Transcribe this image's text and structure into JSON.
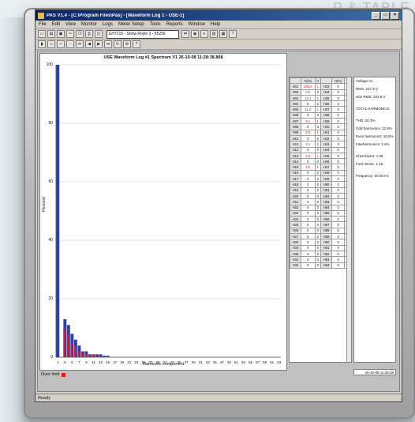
{
  "page": {
    "corner_caption": "P & TABLE"
  },
  "window": {
    "title": "PAS V1.4 - [C:\\Program Files\\Pas] - [Waveform Log 1 - USE-1]",
    "menu": [
      "File",
      "Edit",
      "View",
      "Monitor",
      "Logs",
      "Meter Setup",
      "Tools",
      "Reports",
      "Window",
      "Help"
    ],
    "device_combo": "EH7215 - Show Royle 3 - 85256"
  },
  "chart_data": {
    "type": "bar",
    "title": "USE Waveform Log #1 Spectrum V1 26-10-08 11:28:38.808",
    "xlabel": "Harmonic component",
    "ylabel": "Percent",
    "ylim": [
      0,
      100
    ],
    "yticks": [
      "0",
      "20",
      "40",
      "60",
      "80",
      "100"
    ],
    "xticks": [
      "1",
      "3",
      "5",
      "7",
      "9",
      "11",
      "13",
      "15",
      "17",
      "19",
      "21",
      "23",
      "25",
      "27",
      "29",
      "31",
      "33",
      "35",
      "37",
      "39",
      "41",
      "43",
      "45",
      "47",
      "49",
      "51",
      "53",
      "55",
      "57",
      "59",
      "61",
      "63"
    ],
    "series": [
      {
        "name": "Harmonics",
        "values": [
          100,
          0,
          13,
          11,
          8,
          6,
          4,
          2,
          2,
          1,
          1,
          1,
          1,
          0.5,
          0.5,
          0,
          0,
          0,
          0,
          0,
          0,
          0,
          0,
          0,
          0,
          0,
          0,
          0,
          0,
          0,
          0,
          0,
          0,
          0,
          0,
          0,
          0,
          0,
          0,
          0,
          0,
          0,
          0,
          0,
          0,
          0,
          0,
          0,
          0,
          0,
          0,
          0,
          0,
          0,
          0,
          0,
          0,
          0,
          0,
          0,
          0,
          0,
          0
        ]
      },
      {
        "name": "Over limit",
        "values": [
          0,
          0,
          10,
          8,
          5,
          4,
          2,
          2,
          1,
          1,
          1,
          0.5,
          0.5,
          0,
          0,
          0,
          0,
          0,
          0,
          0,
          0,
          0,
          0,
          0,
          0,
          0,
          0,
          0,
          0,
          0,
          0,
          0,
          0,
          0,
          0,
          0,
          0,
          0,
          0,
          0,
          0,
          0,
          0,
          0,
          0,
          0,
          0,
          0,
          0,
          0,
          0,
          0,
          0,
          0,
          0,
          0,
          0,
          0,
          0,
          0,
          0,
          0,
          0,
          0,
          0
        ]
      }
    ],
    "colors": {
      "normal": "#2a3fb0",
      "over": "#e8191c"
    },
    "grid": true,
    "legend_text": "Over limit"
  },
  "table": {
    "headers": [
      "",
      "H(%)",
      "V",
      "",
      "H(%)",
      "V"
    ],
    "rows": [
      [
        "H01",
        "100.0",
        "1",
        "H33",
        "0",
        "0"
      ],
      [
        "H02",
        "0.0",
        "0",
        "H34",
        "0",
        "0"
      ],
      [
        "H03",
        "13.1",
        "1",
        "H35",
        "0",
        "0"
      ],
      [
        "H04",
        "0",
        "0",
        "H36",
        "0",
        "0"
      ],
      [
        "H05",
        "11.2",
        "1",
        "H37",
        "0",
        "0"
      ],
      [
        "H06",
        "0",
        "0",
        "H38",
        "0",
        "0"
      ],
      [
        "H07",
        "8.1",
        "1",
        "H39",
        "0",
        "0"
      ],
      [
        "H08",
        "0",
        "0",
        "H40",
        "0",
        "0"
      ],
      [
        "H09",
        "6.0",
        "1",
        "H41",
        "0",
        "0"
      ],
      [
        "H10",
        "0",
        "0",
        "H42",
        "0",
        "0"
      ],
      [
        "H11",
        "4.1",
        "1",
        "H43",
        "0",
        "0"
      ],
      [
        "H12",
        "0",
        "0",
        "H44",
        "0",
        "0"
      ],
      [
        "H13",
        "2.2",
        "1",
        "H45",
        "0",
        "0"
      ],
      [
        "H14",
        "0",
        "0",
        "H46",
        "0",
        "0"
      ],
      [
        "H15",
        "1.5",
        "1",
        "H47",
        "0",
        "0"
      ],
      [
        "H16",
        "0",
        "0",
        "H48",
        "0",
        "0"
      ],
      [
        "H17",
        "0",
        "0",
        "H49",
        "0",
        "0"
      ],
      [
        "H18",
        "0",
        "0",
        "H50",
        "0",
        "0"
      ],
      [
        "H19",
        "0",
        "0",
        "H51",
        "0",
        "0"
      ],
      [
        "H20",
        "0",
        "0",
        "H52",
        "0",
        "0"
      ],
      [
        "H21",
        "0",
        "0",
        "H53",
        "0",
        "0"
      ],
      [
        "H22",
        "0",
        "0",
        "H54",
        "0",
        "0"
      ],
      [
        "H23",
        "0",
        "0",
        "H55",
        "0",
        "0"
      ],
      [
        "H24",
        "0",
        "0",
        "H56",
        "0",
        "0"
      ],
      [
        "H25",
        "0",
        "0",
        "H57",
        "0",
        "0"
      ],
      [
        "H26",
        "0",
        "0",
        "H58",
        "0",
        "0"
      ],
      [
        "H27",
        "0",
        "0",
        "H59",
        "0",
        "0"
      ],
      [
        "H28",
        "0",
        "0",
        "H60",
        "0",
        "0"
      ],
      [
        "H29",
        "0",
        "0",
        "H61",
        "0",
        "0"
      ],
      [
        "H30",
        "0",
        "0",
        "H62",
        "0",
        "0"
      ],
      [
        "H31",
        "0",
        "0",
        "H63",
        "0",
        "0"
      ],
      [
        "H32",
        "0",
        "0",
        "H64",
        "0",
        "0"
      ]
    ]
  },
  "info": {
    "voltage": "Voltage V1",
    "rms": "RMS: 227.3 V",
    "h01": "H01 RMS: 223.9 V",
    "total": "TOTAL HARMONICS",
    "thd": "THD: 20.3%",
    "odd": "Odd harmonics: 12.9%",
    "even": "Even harmonics: 15.6%",
    "inter": "Interharmonics: 1.2%",
    "crest": "Crest factor: 1.38",
    "form": "Form factor: 1.16",
    "freq": "Frequency: 50.00 Hz",
    "stamp": "26-10-08 11:28:38"
  },
  "status": "Ready"
}
